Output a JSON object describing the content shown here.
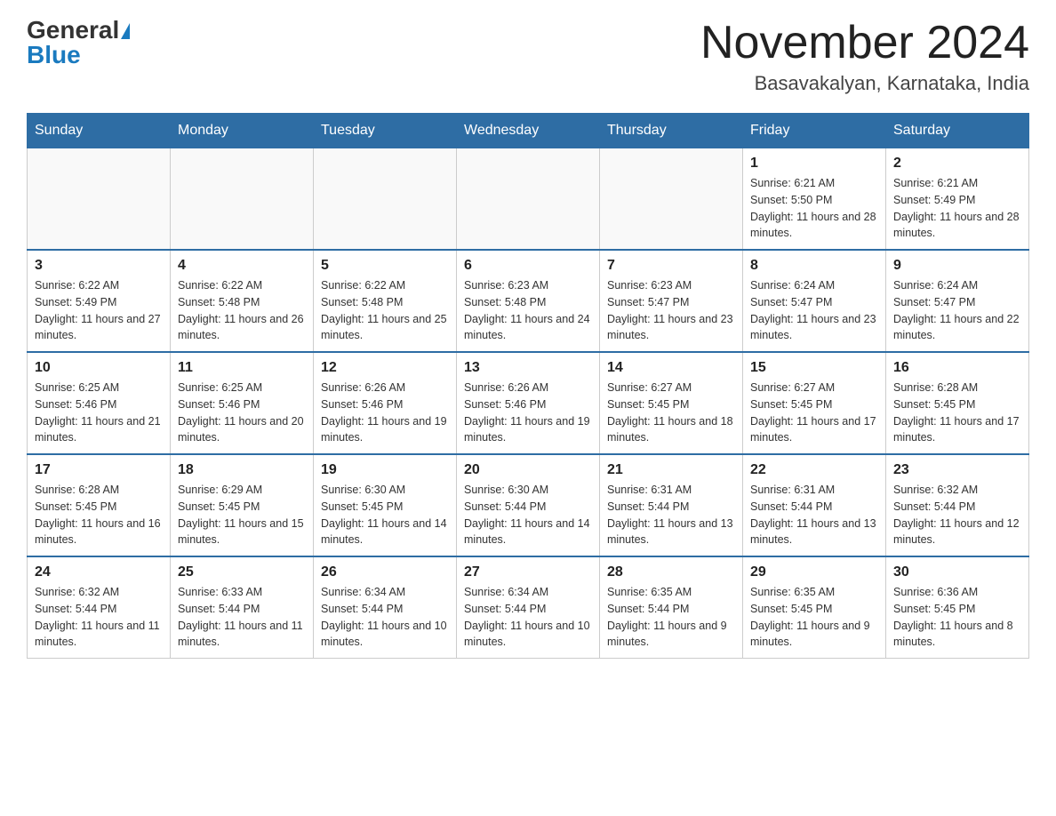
{
  "header": {
    "logo_general": "General",
    "logo_blue": "Blue",
    "month_title": "November 2024",
    "location": "Basavakalyan, Karnataka, India"
  },
  "days_of_week": [
    "Sunday",
    "Monday",
    "Tuesday",
    "Wednesday",
    "Thursday",
    "Friday",
    "Saturday"
  ],
  "weeks": [
    [
      {
        "day": "",
        "info": ""
      },
      {
        "day": "",
        "info": ""
      },
      {
        "day": "",
        "info": ""
      },
      {
        "day": "",
        "info": ""
      },
      {
        "day": "",
        "info": ""
      },
      {
        "day": "1",
        "info": "Sunrise: 6:21 AM\nSunset: 5:50 PM\nDaylight: 11 hours and 28 minutes."
      },
      {
        "day": "2",
        "info": "Sunrise: 6:21 AM\nSunset: 5:49 PM\nDaylight: 11 hours and 28 minutes."
      }
    ],
    [
      {
        "day": "3",
        "info": "Sunrise: 6:22 AM\nSunset: 5:49 PM\nDaylight: 11 hours and 27 minutes."
      },
      {
        "day": "4",
        "info": "Sunrise: 6:22 AM\nSunset: 5:48 PM\nDaylight: 11 hours and 26 minutes."
      },
      {
        "day": "5",
        "info": "Sunrise: 6:22 AM\nSunset: 5:48 PM\nDaylight: 11 hours and 25 minutes."
      },
      {
        "day": "6",
        "info": "Sunrise: 6:23 AM\nSunset: 5:48 PM\nDaylight: 11 hours and 24 minutes."
      },
      {
        "day": "7",
        "info": "Sunrise: 6:23 AM\nSunset: 5:47 PM\nDaylight: 11 hours and 23 minutes."
      },
      {
        "day": "8",
        "info": "Sunrise: 6:24 AM\nSunset: 5:47 PM\nDaylight: 11 hours and 23 minutes."
      },
      {
        "day": "9",
        "info": "Sunrise: 6:24 AM\nSunset: 5:47 PM\nDaylight: 11 hours and 22 minutes."
      }
    ],
    [
      {
        "day": "10",
        "info": "Sunrise: 6:25 AM\nSunset: 5:46 PM\nDaylight: 11 hours and 21 minutes."
      },
      {
        "day": "11",
        "info": "Sunrise: 6:25 AM\nSunset: 5:46 PM\nDaylight: 11 hours and 20 minutes."
      },
      {
        "day": "12",
        "info": "Sunrise: 6:26 AM\nSunset: 5:46 PM\nDaylight: 11 hours and 19 minutes."
      },
      {
        "day": "13",
        "info": "Sunrise: 6:26 AM\nSunset: 5:46 PM\nDaylight: 11 hours and 19 minutes."
      },
      {
        "day": "14",
        "info": "Sunrise: 6:27 AM\nSunset: 5:45 PM\nDaylight: 11 hours and 18 minutes."
      },
      {
        "day": "15",
        "info": "Sunrise: 6:27 AM\nSunset: 5:45 PM\nDaylight: 11 hours and 17 minutes."
      },
      {
        "day": "16",
        "info": "Sunrise: 6:28 AM\nSunset: 5:45 PM\nDaylight: 11 hours and 17 minutes."
      }
    ],
    [
      {
        "day": "17",
        "info": "Sunrise: 6:28 AM\nSunset: 5:45 PM\nDaylight: 11 hours and 16 minutes."
      },
      {
        "day": "18",
        "info": "Sunrise: 6:29 AM\nSunset: 5:45 PM\nDaylight: 11 hours and 15 minutes."
      },
      {
        "day": "19",
        "info": "Sunrise: 6:30 AM\nSunset: 5:45 PM\nDaylight: 11 hours and 14 minutes."
      },
      {
        "day": "20",
        "info": "Sunrise: 6:30 AM\nSunset: 5:44 PM\nDaylight: 11 hours and 14 minutes."
      },
      {
        "day": "21",
        "info": "Sunrise: 6:31 AM\nSunset: 5:44 PM\nDaylight: 11 hours and 13 minutes."
      },
      {
        "day": "22",
        "info": "Sunrise: 6:31 AM\nSunset: 5:44 PM\nDaylight: 11 hours and 13 minutes."
      },
      {
        "day": "23",
        "info": "Sunrise: 6:32 AM\nSunset: 5:44 PM\nDaylight: 11 hours and 12 minutes."
      }
    ],
    [
      {
        "day": "24",
        "info": "Sunrise: 6:32 AM\nSunset: 5:44 PM\nDaylight: 11 hours and 11 minutes."
      },
      {
        "day": "25",
        "info": "Sunrise: 6:33 AM\nSunset: 5:44 PM\nDaylight: 11 hours and 11 minutes."
      },
      {
        "day": "26",
        "info": "Sunrise: 6:34 AM\nSunset: 5:44 PM\nDaylight: 11 hours and 10 minutes."
      },
      {
        "day": "27",
        "info": "Sunrise: 6:34 AM\nSunset: 5:44 PM\nDaylight: 11 hours and 10 minutes."
      },
      {
        "day": "28",
        "info": "Sunrise: 6:35 AM\nSunset: 5:44 PM\nDaylight: 11 hours and 9 minutes."
      },
      {
        "day": "29",
        "info": "Sunrise: 6:35 AM\nSunset: 5:45 PM\nDaylight: 11 hours and 9 minutes."
      },
      {
        "day": "30",
        "info": "Sunrise: 6:36 AM\nSunset: 5:45 PM\nDaylight: 11 hours and 8 minutes."
      }
    ]
  ]
}
